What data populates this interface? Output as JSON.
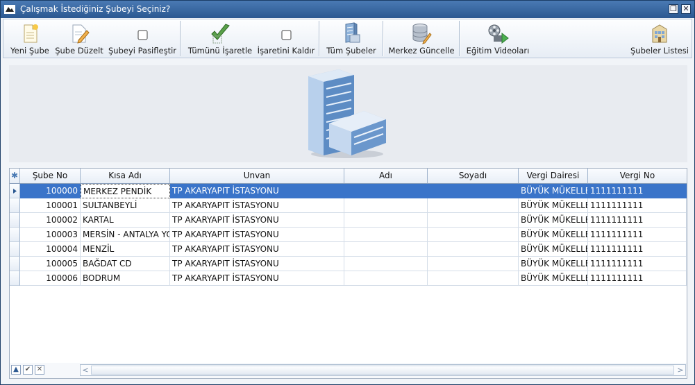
{
  "window": {
    "title": "Çalışmak İstediğiniz Şubeyi Seçiniz?",
    "restore_glyph": "❐",
    "close_glyph": "✕"
  },
  "toolbar": {
    "new_branch": "Yeni Şube",
    "edit_branch": "Şube Düzelt",
    "deactivate_branch": "Şubeyi Pasifleştir",
    "check_all": "Tümünü İşaretle",
    "uncheck": "İşaretini Kaldır",
    "all_branches": "Tüm Şubeler",
    "update_center": "Merkez Güncelle",
    "training_videos": "Eğitim Videoları",
    "branch_list": "Şubeler Listesi"
  },
  "grid": {
    "new_row_glyph": "✱",
    "columns": {
      "branch_no": "Şube No",
      "short_name": "Kısa Adı",
      "title": "Unvan",
      "first_name": "Adı",
      "last_name": "Soyadı",
      "tax_office": "Vergi Dairesi",
      "tax_no": "Vergi No"
    },
    "rows": [
      {
        "branch_no": "100000",
        "short_name": "MERKEZ PENDİK",
        "title": "TP AKARYAPIT İSTASYONU",
        "first_name": "",
        "last_name": "",
        "tax_office": "BÜYÜK MÜKELLEF",
        "tax_no": "1111111111"
      },
      {
        "branch_no": "100001",
        "short_name": "SULTANBEYLİ",
        "title": "TP AKARYAPIT İSTASYONU",
        "first_name": "",
        "last_name": "",
        "tax_office": "BÜYÜK MÜKELLEF",
        "tax_no": "1111111111"
      },
      {
        "branch_no": "100002",
        "short_name": "KARTAL",
        "title": "TP AKARYAPIT İSTASYONU",
        "first_name": "",
        "last_name": "",
        "tax_office": "BÜYÜK MÜKELLEF",
        "tax_no": "1111111111"
      },
      {
        "branch_no": "100003",
        "short_name": "MERSİN - ANTALYA YOLU",
        "title": "TP AKARYAPIT İSTASYONU",
        "first_name": "",
        "last_name": "",
        "tax_office": "BÜYÜK MÜKELLEF",
        "tax_no": "1111111111"
      },
      {
        "branch_no": "100004",
        "short_name": "MENZİL",
        "title": "TP AKARYAPIT İSTASYONU",
        "first_name": "",
        "last_name": "",
        "tax_office": "BÜYÜK MÜKELLEF",
        "tax_no": "1111111111"
      },
      {
        "branch_no": "100005",
        "short_name": "BAĞDAT CD",
        "title": "TP AKARYAPIT İSTASYONU",
        "first_name": "",
        "last_name": "",
        "tax_office": "BÜYÜK MÜKELLEF",
        "tax_no": "1111111111"
      },
      {
        "branch_no": "100006",
        "short_name": "BODRUM",
        "title": "TP AKARYAPIT İSTASYONU",
        "first_name": "",
        "last_name": "",
        "tax_office": "BÜYÜK MÜKELLEF",
        "tax_no": "1111111111"
      }
    ],
    "selected_index": 0
  },
  "navigator": {
    "up_glyph": "▲",
    "check_glyph": "✔",
    "cancel_glyph": "✕",
    "scroll_left_glyph": "<",
    "scroll_right_glyph": ">"
  },
  "icons": {
    "app": "app-icon",
    "new_branch": "new-document-icon",
    "edit_branch": "edit-document-icon",
    "deactivate": "checkbox-icon",
    "check_all": "checkmark-icon",
    "uncheck": "checkbox-icon",
    "all_branches": "building-icon",
    "update_center": "database-icon",
    "training_videos": "film-reel-icon",
    "branch_list": "building-icon",
    "banner": "office-building-icon"
  },
  "colors": {
    "titlebar": "#2b5891",
    "selection": "#3a74c9",
    "banner_bg": "#e8ebf0"
  }
}
